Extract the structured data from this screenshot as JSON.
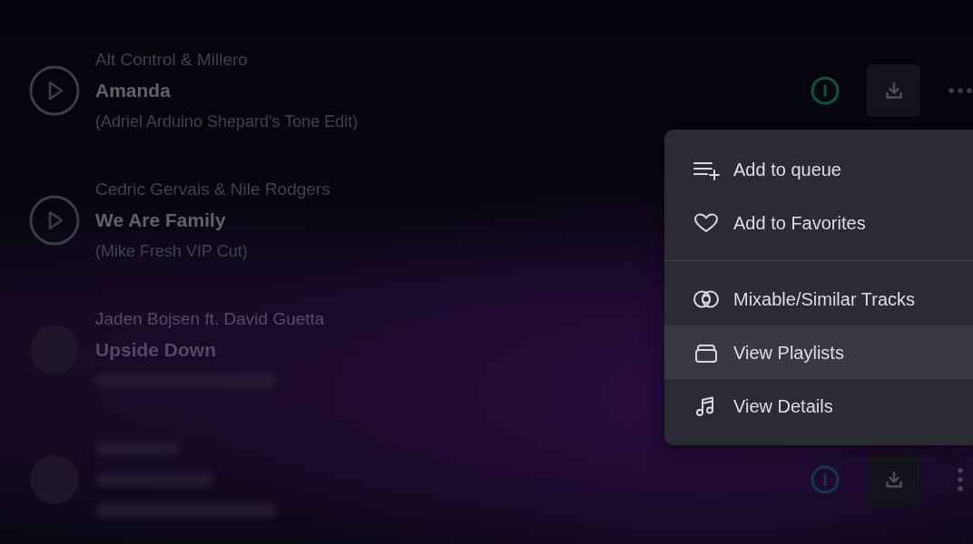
{
  "tracks": [
    {
      "dimmed": false,
      "lines": [
        {
          "kind": "artist",
          "text": "Alt Control & Millero"
        },
        {
          "kind": "title",
          "text": "Amanda"
        },
        {
          "kind": "version",
          "text": "(Adriel Arduino Shepard's Tone Edit)"
        }
      ],
      "actions": {
        "more": {
          "kind": "horizontal"
        }
      }
    },
    {
      "dimmed": false,
      "lines": [
        {
          "kind": "artist",
          "text": "Cedric Gervais & Nile Rodgers"
        },
        {
          "kind": "title",
          "text": "We Are Family"
        },
        {
          "kind": "version",
          "text": "(Mike Fresh VIP Cut)"
        }
      ]
    },
    {
      "dimmed": true,
      "lines": [
        {
          "kind": "artist",
          "text": "Jaden Bojsen ft. David Guetta"
        },
        {
          "kind": "title",
          "text": "Upside Down"
        },
        {
          "kind": "illegible"
        }
      ]
    },
    {
      "dimmed": true,
      "lines": [
        {
          "kind": "illegible"
        },
        {
          "kind": "illegible"
        },
        {
          "kind": "illegible"
        }
      ],
      "actions": {
        "more": {
          "kind": "vertical"
        }
      }
    }
  ],
  "menu": {
    "sections": [
      {
        "items": [
          {
            "label": "Add to queue",
            "highlighted": false
          },
          {
            "label": "Add to Favorites",
            "highlighted": false
          }
        ]
      },
      {
        "items": [
          {
            "label": "Mixable/Similar Tracks",
            "highlighted": false
          },
          {
            "label": "View Playlists",
            "highlighted": true
          },
          {
            "label": "View Details",
            "highlighted": false
          }
        ]
      }
    ]
  }
}
